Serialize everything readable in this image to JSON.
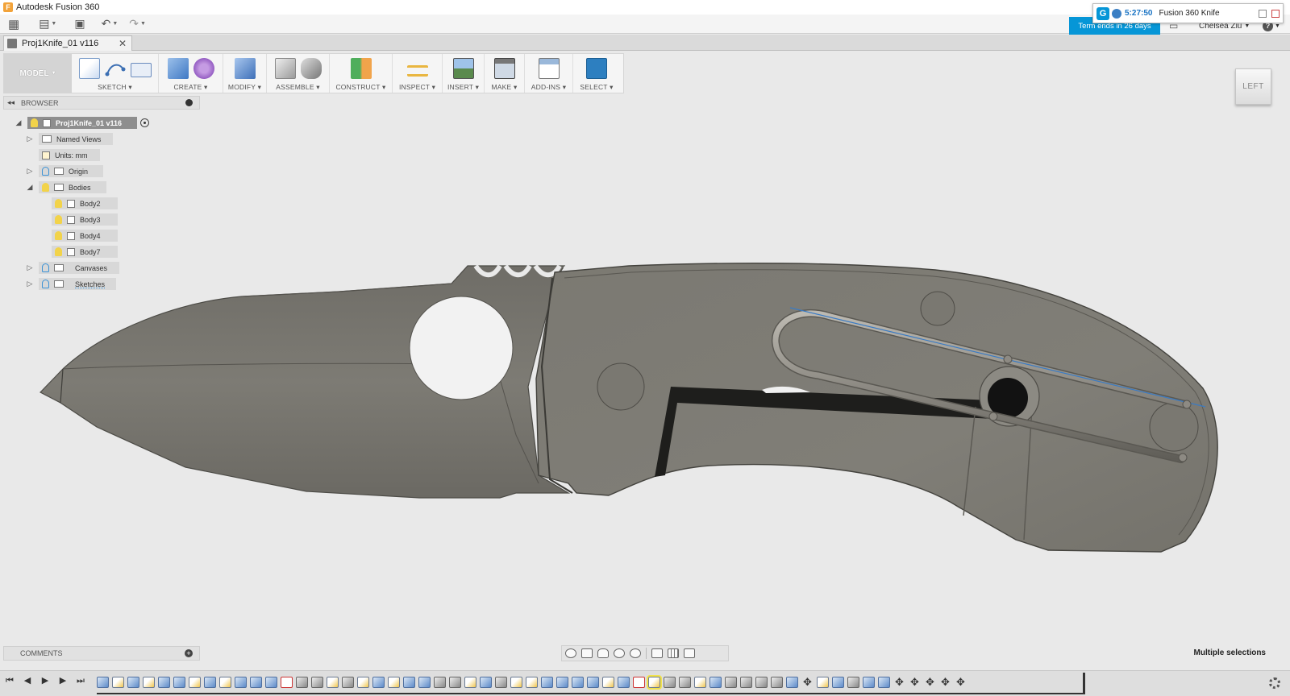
{
  "app": {
    "title": "Autodesk Fusion 360",
    "icon_letter": "F"
  },
  "qat": {
    "icons": [
      "apps-grid-icon",
      "file-icon",
      "save-icon",
      "undo-icon",
      "redo-icon"
    ]
  },
  "notification": {
    "timer": "5:27:50",
    "title": "Fusion 360 Knife"
  },
  "term_banner": "Term ends in 26 days",
  "user": {
    "name": "Chelsea Ziu",
    "help": "?"
  },
  "document_tab": {
    "label": "Proj1Knife_01 v116",
    "close": "✕"
  },
  "ribbon": {
    "workspace": "MODEL",
    "groups": [
      {
        "label": "SKETCH"
      },
      {
        "label": "CREATE"
      },
      {
        "label": "MODIFY"
      },
      {
        "label": "ASSEMBLE"
      },
      {
        "label": "CONSTRUCT"
      },
      {
        "label": "INSPECT"
      },
      {
        "label": "INSERT"
      },
      {
        "label": "MAKE"
      },
      {
        "label": "ADD-INS"
      },
      {
        "label": "SELECT"
      }
    ]
  },
  "browser": {
    "title": "BROWSER",
    "root": "Proj1Knife_01 v116",
    "items": {
      "named_views": "Named Views",
      "units": "Units: mm",
      "origin": "Origin",
      "bodies": "Bodies",
      "body2": "Body2",
      "body3": "Body3",
      "body4": "Body4",
      "body7": "Body7",
      "canvases": "Canvases",
      "sketches": "Sketches"
    }
  },
  "viewcube": {
    "face": "LEFT"
  },
  "comments": {
    "title": "COMMENTS"
  },
  "status": {
    "selection": "Multiple selections"
  },
  "colors": {
    "accent": "#0696d7",
    "model_body": "#7a7770",
    "canvas_bg": "#e9e9e9"
  }
}
